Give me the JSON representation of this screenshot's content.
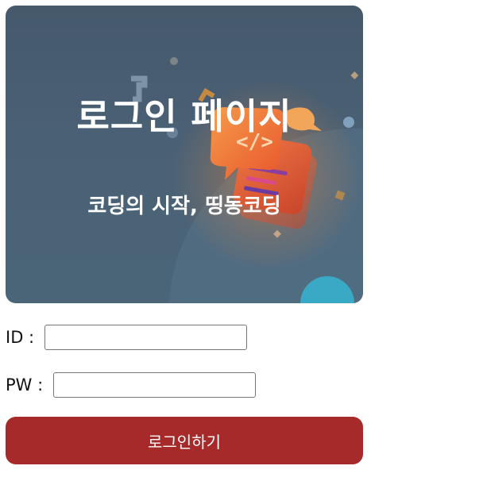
{
  "hero": {
    "title": "로그인 페이지",
    "subtitle": "코딩의 시작, 띵동코딩"
  },
  "form": {
    "id_label": "ID : ",
    "id_value": "",
    "pw_label": "PW : ",
    "pw_value": "",
    "submit_label": "로그인하기"
  },
  "colors": {
    "hero_background": "#46596c",
    "button_background": "#a62a2a",
    "button_text": "#ffffff"
  },
  "icons": {
    "hero_illustration": "code-chat-illustration"
  }
}
